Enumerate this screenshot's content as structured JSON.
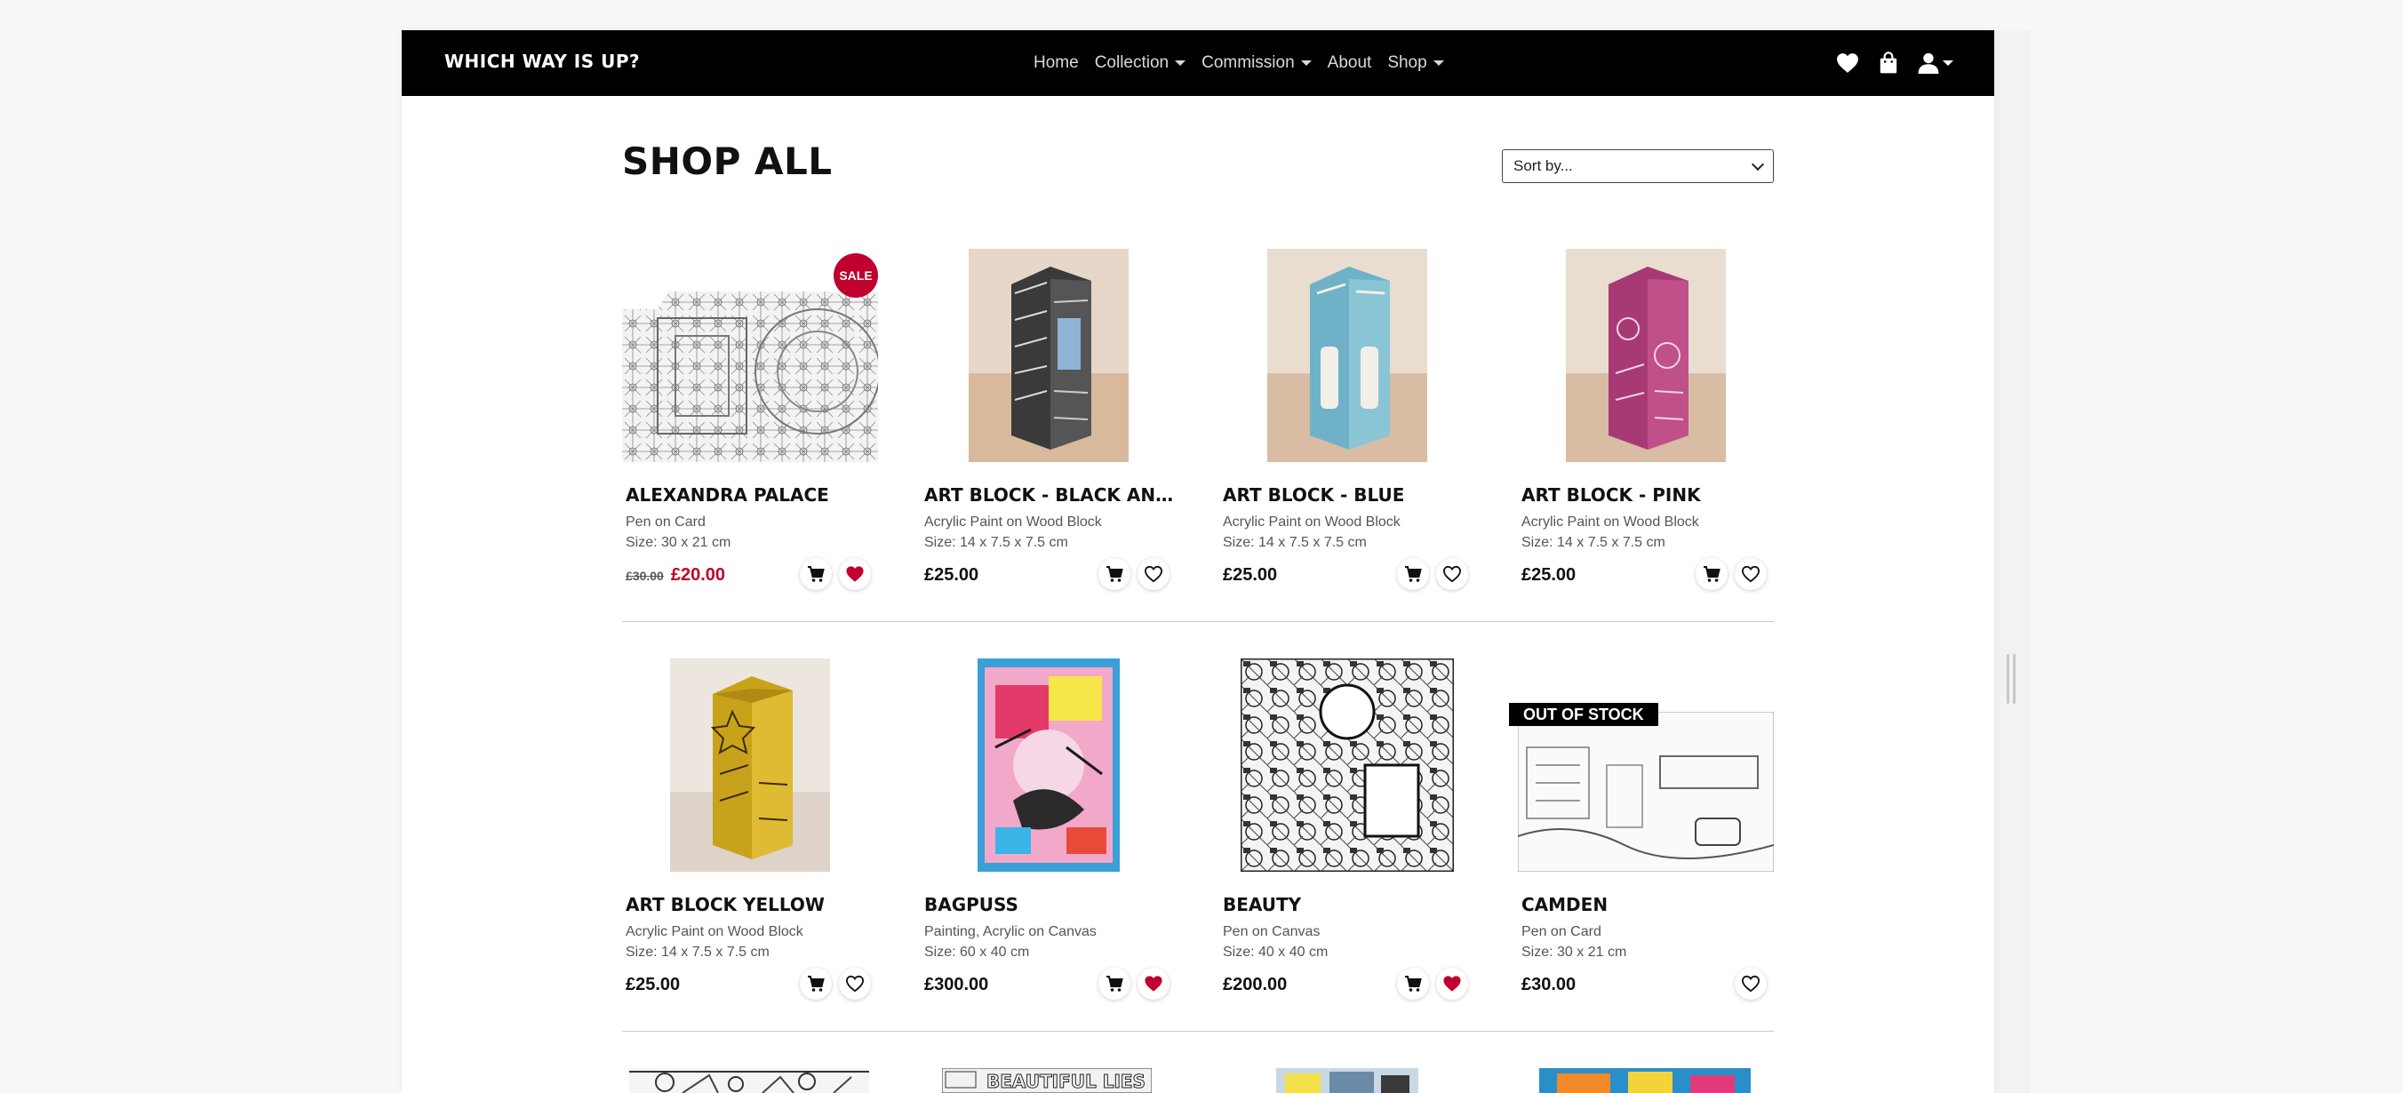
{
  "nav": {
    "brand": "which way is up?",
    "links": [
      {
        "label": "Home",
        "dropdown": false
      },
      {
        "label": "Collection",
        "dropdown": true
      },
      {
        "label": "Commission",
        "dropdown": true
      },
      {
        "label": "About",
        "dropdown": false
      },
      {
        "label": "Shop",
        "dropdown": true
      }
    ],
    "icons": [
      "heart-icon",
      "shopping-bag-icon",
      "user-icon"
    ]
  },
  "header": {
    "title": "Shop All",
    "sort_label": "Sort by..."
  },
  "colors": {
    "accent": "#c0002e",
    "navbar": "#000000"
  },
  "products": [
    {
      "name": "Alexandra Palace",
      "medium": "Pen on Card",
      "size": "Size: 30 x 21 cm",
      "price": "£20.00",
      "old_price": "£30.00",
      "badge": "SALE",
      "wishlisted": true,
      "in_stock": true
    },
    {
      "name": "Art Block - Black and White",
      "medium": "Acrylic Paint on Wood Block",
      "size": "Size: 14 x 7.5 x 7.5 cm",
      "price": "£25.00",
      "wishlisted": false,
      "in_stock": true
    },
    {
      "name": "Art Block - Blue",
      "medium": "Acrylic Paint on Wood Block",
      "size": "Size: 14 x 7.5 x 7.5 cm",
      "price": "£25.00",
      "wishlisted": false,
      "in_stock": true
    },
    {
      "name": "Art Block - Pink",
      "medium": "Acrylic Paint on Wood Block",
      "size": "Size: 14 x 7.5 x 7.5 cm",
      "price": "£25.00",
      "wishlisted": false,
      "in_stock": true
    },
    {
      "name": "Art Block Yellow",
      "medium": "Acrylic Paint on Wood Block",
      "size": "Size: 14 x 7.5 x 7.5 cm",
      "price": "£25.00",
      "wishlisted": false,
      "in_stock": true
    },
    {
      "name": "Bagpuss",
      "medium": "Painting, Acrylic on Canvas",
      "size": "Size: 60 x 40 cm",
      "price": "£300.00",
      "wishlisted": true,
      "in_stock": true
    },
    {
      "name": "Beauty",
      "medium": "Pen on Canvas",
      "size": "Size: 40 x 40 cm",
      "price": "£200.00",
      "wishlisted": true,
      "in_stock": true
    },
    {
      "name": "Camden",
      "medium": "Pen on Card",
      "size": "Size: 30 x 21 cm",
      "price": "£30.00",
      "badge": "OUT OF STOCK",
      "wishlisted": false,
      "in_stock": false
    }
  ],
  "partial_row_images": [
    "doodle-artwork",
    "beautiful-lies-artwork",
    "street-painting-artwork",
    "colourful-painting-artwork"
  ]
}
